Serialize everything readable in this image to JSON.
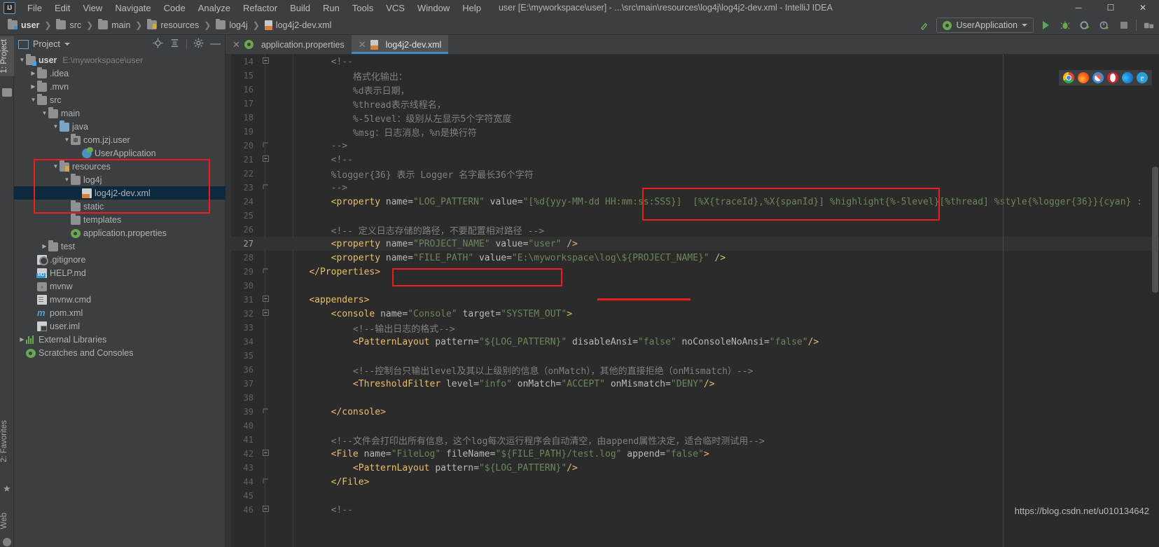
{
  "window": {
    "title": "user [E:\\myworkspace\\user] - ...\\src\\main\\resources\\log4j\\log4j2-dev.xml - IntelliJ IDEA",
    "logo_text": "IJ",
    "minimize": "─",
    "maximize": "☐",
    "close": "✕"
  },
  "menu": [
    {
      "label": "File"
    },
    {
      "label": "Edit"
    },
    {
      "label": "View"
    },
    {
      "label": "Navigate"
    },
    {
      "label": "Code"
    },
    {
      "label": "Analyze"
    },
    {
      "label": "Refactor"
    },
    {
      "label": "Build"
    },
    {
      "label": "Run"
    },
    {
      "label": "Tools"
    },
    {
      "label": "VCS"
    },
    {
      "label": "Window"
    },
    {
      "label": "Help"
    }
  ],
  "breadcrumb": [
    {
      "label": "user",
      "icon": "module-folder-icon"
    },
    {
      "label": "src",
      "icon": "folder-icon"
    },
    {
      "label": "main",
      "icon": "folder-icon"
    },
    {
      "label": "resources",
      "icon": "resources-folder-icon"
    },
    {
      "label": "log4j",
      "icon": "folder-icon"
    },
    {
      "label": "log4j2-dev.xml",
      "icon": "xml-file-icon"
    }
  ],
  "toolbar": {
    "run_config": "UserApplication",
    "build_icon": "hammer-icon",
    "run_icon": "run-icon",
    "debug_icon": "debug-icon",
    "run_coverage_icon": "run-with-coverage-icon",
    "profile_icon": "profiler-icon",
    "stop_icon": "stop-icon",
    "project_structure_icon": "project-structure-icon"
  },
  "left_strip": [
    {
      "label": "1: Project",
      "active": true
    },
    {
      "label": "2: Favorites",
      "active": false
    },
    {
      "label": "Web",
      "active": false
    }
  ],
  "project_panel": {
    "title": "Project",
    "icons": [
      "locate-icon",
      "collapse-all-icon",
      "settings-gear-icon",
      "hide-icon"
    ],
    "tree": [
      {
        "depth": 0,
        "arrow": "down",
        "icon": "module-folder-icon",
        "label": "user",
        "bold": true,
        "sub": "E:\\myworkspace\\user"
      },
      {
        "depth": 1,
        "arrow": "right",
        "icon": "folder-icon",
        "label": ".idea",
        "bold": false,
        "sub": ""
      },
      {
        "depth": 1,
        "arrow": "right",
        "icon": "folder-icon",
        "label": ".mvn",
        "bold": false,
        "sub": ""
      },
      {
        "depth": 1,
        "arrow": "down",
        "icon": "folder-icon",
        "label": "src",
        "bold": false,
        "sub": ""
      },
      {
        "depth": 2,
        "arrow": "down",
        "icon": "folder-icon",
        "label": "main",
        "bold": false,
        "sub": ""
      },
      {
        "depth": 3,
        "arrow": "down",
        "icon": "source-folder-icon",
        "label": "java",
        "bold": false,
        "sub": ""
      },
      {
        "depth": 4,
        "arrow": "down",
        "icon": "package-icon",
        "label": "com.jzj.user",
        "bold": false,
        "sub": ""
      },
      {
        "depth": 5,
        "arrow": "none",
        "icon": "spring-app-icon",
        "label": "UserApplication",
        "bold": false,
        "sub": ""
      },
      {
        "depth": 3,
        "arrow": "down",
        "icon": "resources-folder-icon",
        "label": "resources",
        "bold": false,
        "sub": ""
      },
      {
        "depth": 4,
        "arrow": "down",
        "icon": "folder-icon",
        "label": "log4j",
        "bold": false,
        "sub": ""
      },
      {
        "depth": 5,
        "arrow": "none",
        "icon": "xml-file-icon",
        "label": "log4j2-dev.xml",
        "bold": false,
        "sub": "",
        "selected": true
      },
      {
        "depth": 4,
        "arrow": "none",
        "icon": "folder-icon",
        "label": "static",
        "bold": false,
        "sub": ""
      },
      {
        "depth": 4,
        "arrow": "none",
        "icon": "folder-icon",
        "label": "templates",
        "bold": false,
        "sub": ""
      },
      {
        "depth": 4,
        "arrow": "none",
        "icon": "properties-file-icon",
        "label": "application.properties",
        "bold": false,
        "sub": ""
      },
      {
        "depth": 2,
        "arrow": "right",
        "icon": "folder-icon",
        "label": "test",
        "bold": false,
        "sub": ""
      },
      {
        "depth": 1,
        "arrow": "none",
        "icon": "gitignore-file-icon",
        "label": ".gitignore",
        "bold": false,
        "sub": ""
      },
      {
        "depth": 1,
        "arrow": "none",
        "icon": "markdown-file-icon",
        "label": "HELP.md",
        "bold": false,
        "sub": ""
      },
      {
        "depth": 1,
        "arrow": "none",
        "icon": "script-file-icon",
        "label": "mvnw",
        "bold": false,
        "sub": ""
      },
      {
        "depth": 1,
        "arrow": "none",
        "icon": "cmd-file-icon",
        "label": "mvnw.cmd",
        "bold": false,
        "sub": ""
      },
      {
        "depth": 1,
        "arrow": "none",
        "icon": "maven-file-icon",
        "label": "pom.xml",
        "bold": false,
        "sub": ""
      },
      {
        "depth": 1,
        "arrow": "none",
        "icon": "iml-file-icon",
        "label": "user.iml",
        "bold": false,
        "sub": ""
      },
      {
        "depth": 0,
        "arrow": "right",
        "icon": "external-libraries-icon",
        "label": "External Libraries",
        "bold": false,
        "sub": ""
      },
      {
        "depth": 0,
        "arrow": "none",
        "icon": "scratches-icon",
        "label": "Scratches and Consoles",
        "bold": false,
        "sub": ""
      }
    ]
  },
  "editor": {
    "tabs": [
      {
        "label": "application.properties",
        "icon": "properties-file-icon",
        "active": false
      },
      {
        "label": "log4j2-dev.xml",
        "icon": "xml-file-icon",
        "active": true
      }
    ],
    "browsers": [
      "chrome-icon",
      "firefox-icon",
      "safari-icon",
      "opera-icon",
      "edge-icon",
      "ie-icon"
    ],
    "lines": [
      {
        "n": "14",
        "fold": "minus",
        "text": "        <!--"
      },
      {
        "n": "15",
        "fold": "",
        "text": "            格式化输出："
      },
      {
        "n": "16",
        "fold": "",
        "text": "            %d表示日期，"
      },
      {
        "n": "17",
        "fold": "",
        "text": "            %thread表示线程名，"
      },
      {
        "n": "18",
        "fold": "",
        "text": "            %-5level：级别从左显示5个字符宽度"
      },
      {
        "n": "19",
        "fold": "",
        "text": "            %msg：日志消息，%n是换行符"
      },
      {
        "n": "20",
        "fold": "end",
        "text": "        -->"
      },
      {
        "n": "21",
        "fold": "minus",
        "text": "        <!--"
      },
      {
        "n": "22",
        "fold": "",
        "text": "        %logger{36} 表示 Logger 名字最长36个字符"
      },
      {
        "n": "23",
        "fold": "end",
        "text": "        -->"
      },
      {
        "n": "24",
        "fold": "",
        "text": "        <property name=\"LOG_PATTERN\" value=\"[%d{yyy-MM-dd HH:mm:ss:SSS}]  [%X{traceId},%X{spanId}] %highlight{%-5level}[%thread] %style{%logger{36}}{cyan} :"
      },
      {
        "n": "25",
        "fold": "",
        "text": ""
      },
      {
        "n": "26",
        "fold": "",
        "text": "        <!-- 定义日志存储的路径，不要配置相对路径 -->"
      },
      {
        "n": "27",
        "fold": "",
        "text": "        <property name=\"PROJECT_NAME\" value=\"user\" />",
        "current": true
      },
      {
        "n": "28",
        "fold": "",
        "text": "        <property name=\"FILE_PATH\" value=\"E:\\myworkspace\\log\\${PROJECT_NAME}\" />"
      },
      {
        "n": "29",
        "fold": "end",
        "text": "    </Properties>"
      },
      {
        "n": "30",
        "fold": "",
        "text": ""
      },
      {
        "n": "31",
        "fold": "minus",
        "text": "    <appenders>"
      },
      {
        "n": "32",
        "fold": "minus",
        "text": "        <console name=\"Console\" target=\"SYSTEM_OUT\">"
      },
      {
        "n": "33",
        "fold": "",
        "text": "            <!--输出日志的格式-->"
      },
      {
        "n": "34",
        "fold": "",
        "text": "            <PatternLayout pattern=\"${LOG_PATTERN}\" disableAnsi=\"false\" noConsoleNoAnsi=\"false\"/>"
      },
      {
        "n": "35",
        "fold": "",
        "text": ""
      },
      {
        "n": "36",
        "fold": "",
        "text": "            <!--控制台只输出level及其以上级别的信息（onMatch），其他的直接拒绝（onMismatch）-->"
      },
      {
        "n": "37",
        "fold": "",
        "text": "            <ThresholdFilter level=\"info\" onMatch=\"ACCEPT\" onMismatch=\"DENY\"/>"
      },
      {
        "n": "38",
        "fold": "",
        "text": ""
      },
      {
        "n": "39",
        "fold": "end",
        "text": "        </console>"
      },
      {
        "n": "40",
        "fold": "",
        "text": ""
      },
      {
        "n": "41",
        "fold": "",
        "text": "        <!--文件会打印出所有信息，这个log每次运行程序会自动清空，由append属性决定，适合临时测试用-->"
      },
      {
        "n": "42",
        "fold": "minus",
        "text": "        <File name=\"FileLog\" fileName=\"${FILE_PATH}/test.log\" append=\"false\">"
      },
      {
        "n": "43",
        "fold": "",
        "text": "            <PatternLayout pattern=\"${LOG_PATTERN}\"/>"
      },
      {
        "n": "44",
        "fold": "end",
        "text": "        </File>"
      },
      {
        "n": "45",
        "fold": "",
        "text": ""
      },
      {
        "n": "46",
        "fold": "minus",
        "text": "        <!--"
      }
    ]
  },
  "watermark": "https://blog.csdn.net/u010134642",
  "colors": {
    "accent": "#4387c7",
    "annotation_red": "#ee1c1c",
    "selection": "#214283",
    "tree_selected": "#0d293e",
    "string": "#6a8759",
    "tag": "#e8bf6a",
    "comment": "#808080",
    "bg_editor": "#2b2b2b",
    "bg_chrome": "#3c3f41"
  }
}
